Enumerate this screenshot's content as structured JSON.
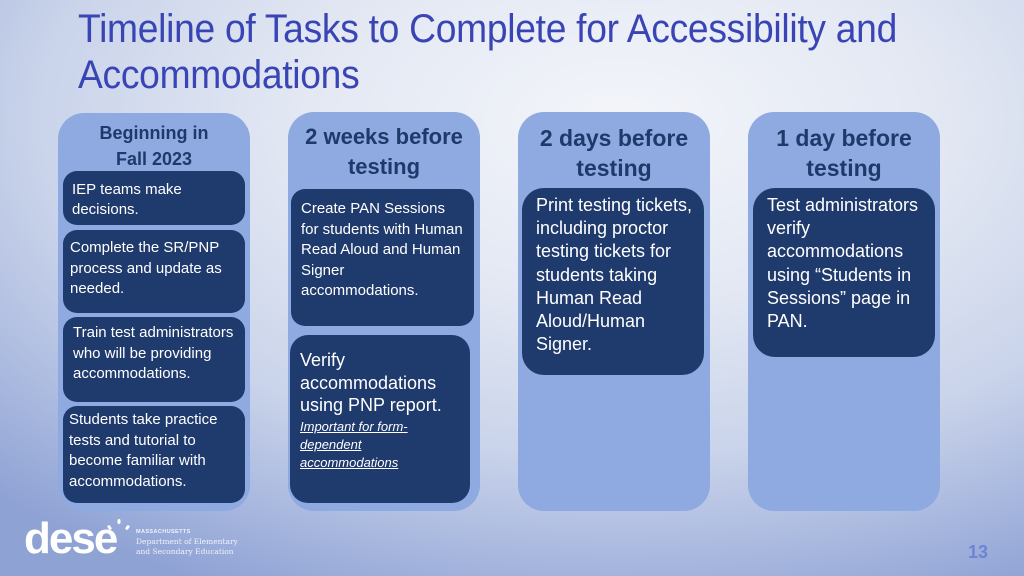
{
  "slide": {
    "title": "Timeline of Tasks to Complete for Accessibility and Accommodations",
    "page_number": "13"
  },
  "columns": [
    {
      "heading": "Beginning in Fall 2023",
      "tasks": [
        {
          "text": "IEP teams make decisions."
        },
        {
          "text": "Complete the SR/PNP process and update as needed."
        },
        {
          "text": "Train test administrators who will be providing accommodations."
        },
        {
          "text": "Students take practice tests and tutorial to become familiar with accommodations."
        }
      ]
    },
    {
      "heading": "2 weeks before testing",
      "tasks": [
        {
          "text": "Create PAN Sessions for students with Human Read Aloud and Human Signer accommodations."
        },
        {
          "text": "Verify accommodations using PNP report.",
          "note": "Important for form-dependent accommodations"
        }
      ]
    },
    {
      "heading": "2 days before testing",
      "tasks": [
        {
          "text": "Print testing tickets, including proctor testing tickets for students taking Human Read Aloud/Human Signer."
        }
      ]
    },
    {
      "heading": "1 day before testing",
      "tasks": [
        {
          "text": "Test administrators verify accommodations using “Students in Sessions” page in PAN."
        }
      ]
    }
  ],
  "logo": {
    "wordmark": "dese",
    "state": "MASSACHUSETTS",
    "org_line1": "Department of Elementary",
    "org_line2": "and Secondary Education"
  },
  "colors": {
    "title": "#3a45b5",
    "column_bg": "#8eaae0",
    "column_heading": "#1d3a6b",
    "task_box": "#1f3a6c",
    "page_number": "#6f83d6"
  }
}
